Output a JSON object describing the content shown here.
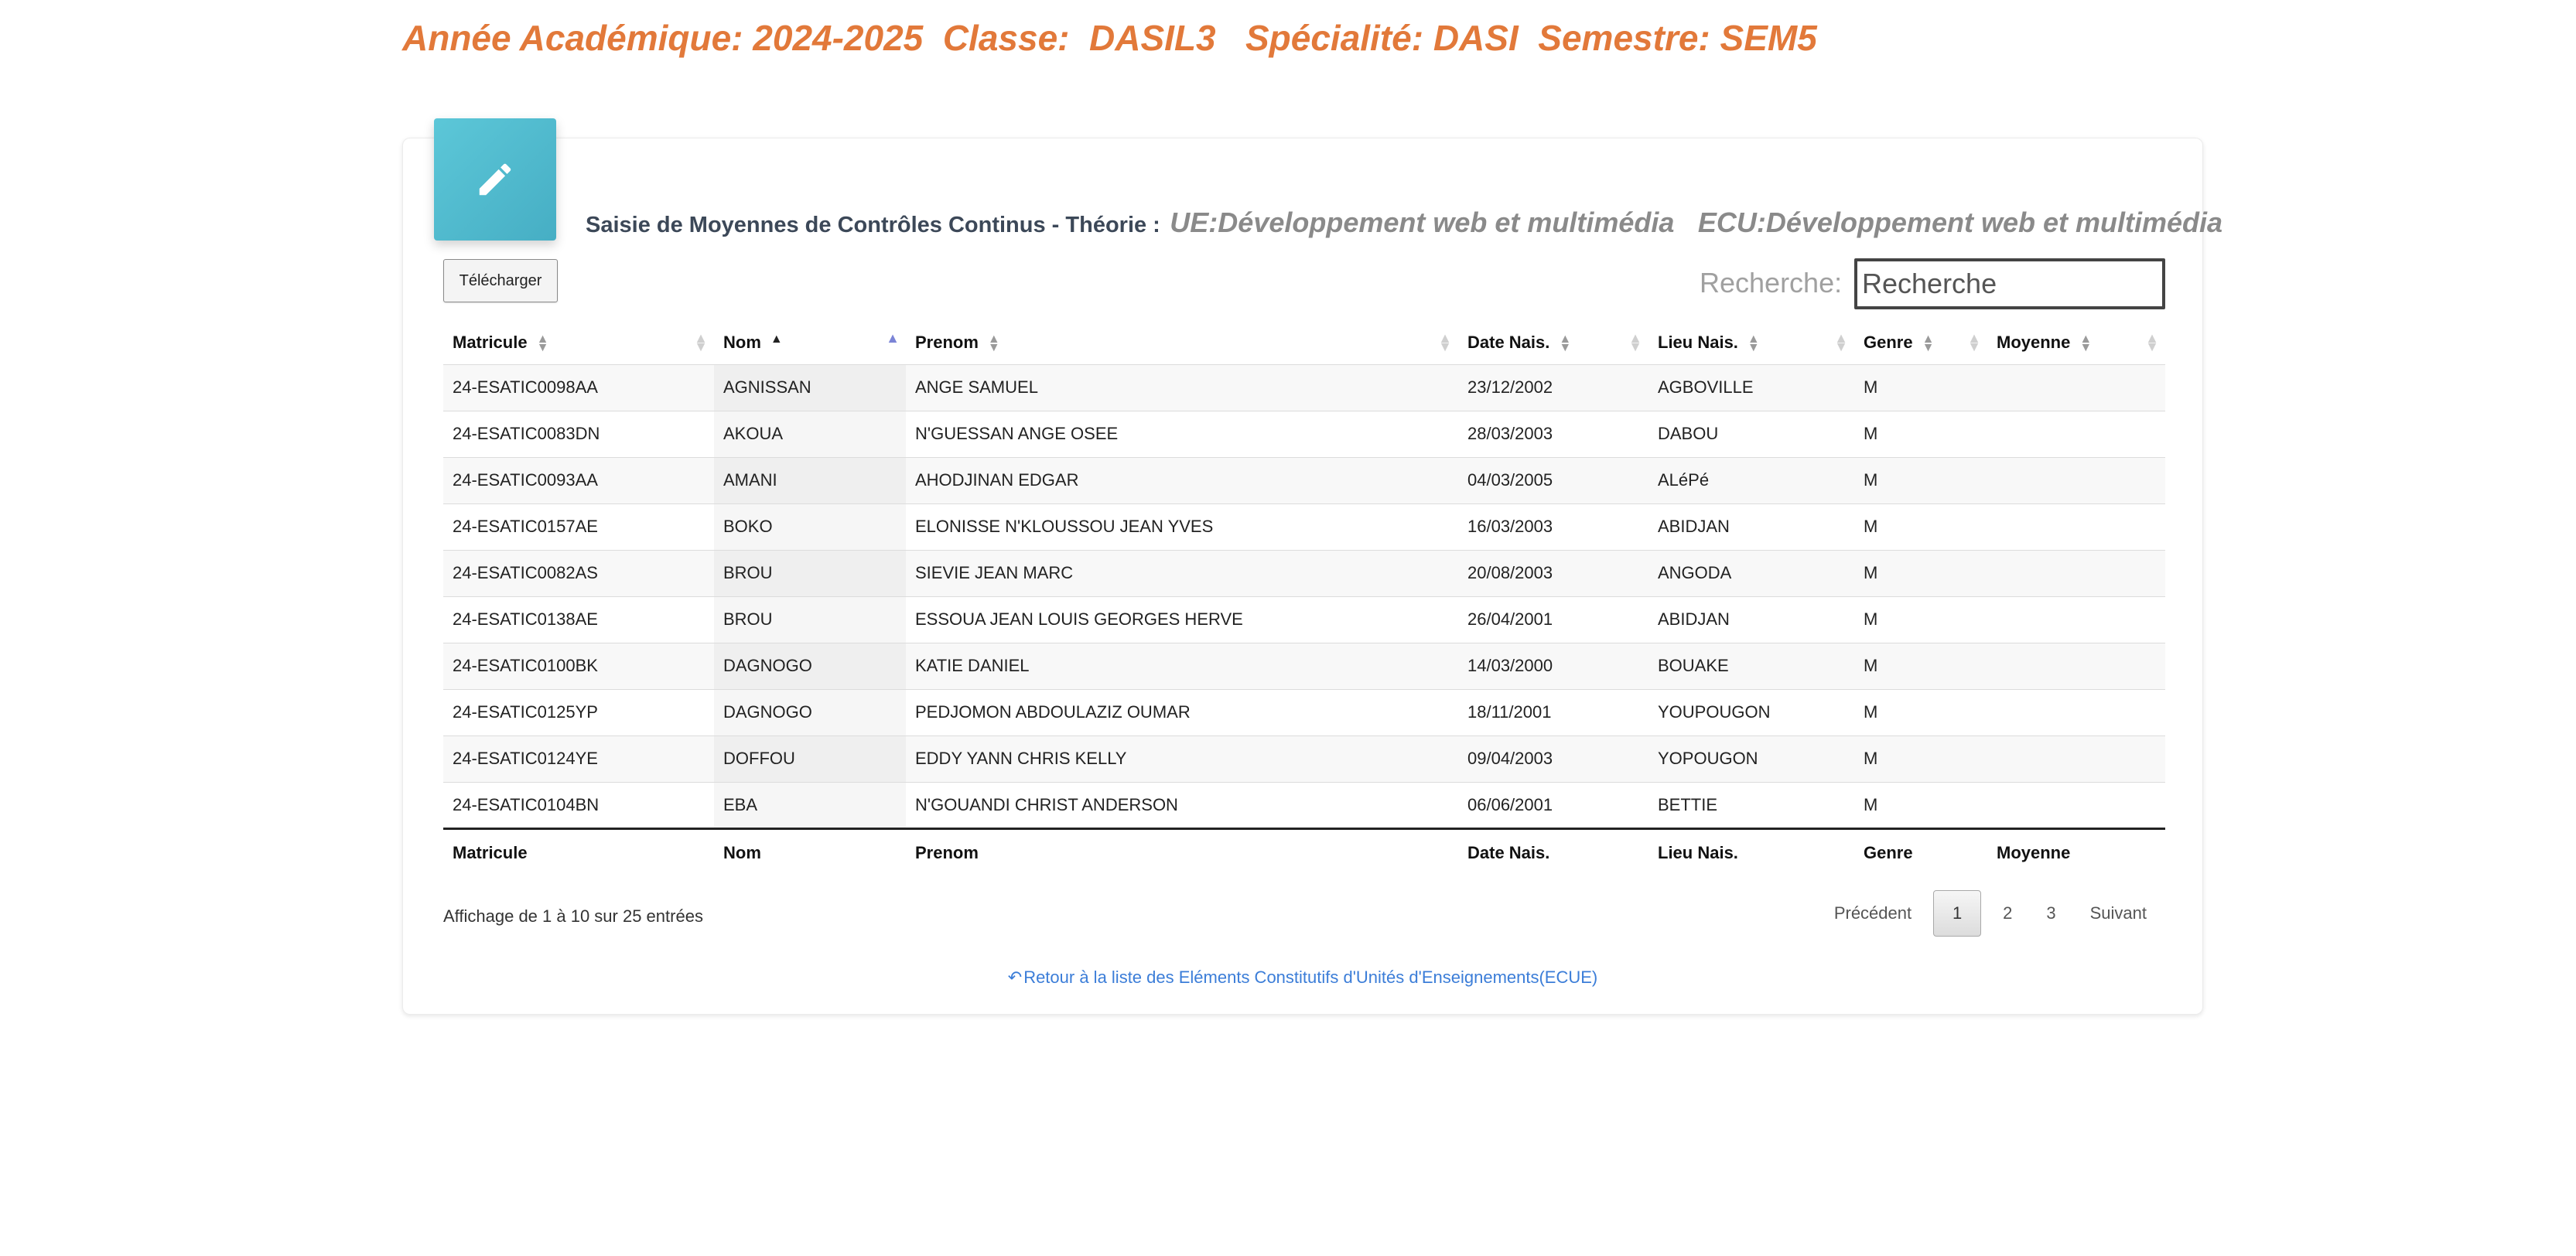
{
  "header": {
    "text": "Année Académique: 2024-2025  Classe:  DASIL3   Spécialité: DASI  Semestre: SEM5"
  },
  "card": {
    "title": "Saisie de Moyennes de Contrôles Continus - Théorie :",
    "ue": "UE:Développement web et multimédia",
    "ecu": "ECU:Développement web et multimédia",
    "icon": "pencil-icon",
    "accent_color": "#52bdd0"
  },
  "toolbar": {
    "download_label": "Télécharger",
    "search_label": "Recherche:",
    "search_placeholder": "Recherche",
    "search_value": ""
  },
  "table": {
    "columns": [
      "Matricule",
      "Nom",
      "Prenom",
      "Date Nais.",
      "Lieu Nais.",
      "Genre",
      "Moyenne"
    ],
    "sorted_column": "Nom",
    "sort_direction": "asc",
    "rows": [
      [
        "24-ESATIC0098AA",
        "AGNISSAN",
        "ANGE SAMUEL",
        "23/12/2002",
        "AGBOVILLE",
        "M",
        ""
      ],
      [
        "24-ESATIC0083DN",
        "AKOUA",
        "N'GUESSAN ANGE OSEE",
        "28/03/2003",
        "DABOU",
        "M",
        ""
      ],
      [
        "24-ESATIC0093AA",
        "AMANI",
        "AHODJINAN EDGAR",
        "04/03/2005",
        "ALéPé",
        "M",
        ""
      ],
      [
        "24-ESATIC0157AE",
        "BOKO",
        "ELONISSE N'KLOUSSOU JEAN YVES",
        "16/03/2003",
        "ABIDJAN",
        "M",
        ""
      ],
      [
        "24-ESATIC0082AS",
        "BROU",
        "SIEVIE JEAN MARC",
        "20/08/2003",
        "ANGODA",
        "M",
        ""
      ],
      [
        "24-ESATIC0138AE",
        "BROU",
        "ESSOUA JEAN LOUIS GEORGES HERVE",
        "26/04/2001",
        "ABIDJAN",
        "M",
        ""
      ],
      [
        "24-ESATIC0100BK",
        "DAGNOGO",
        "KATIE DANIEL",
        "14/03/2000",
        "BOUAKE",
        "M",
        ""
      ],
      [
        "24-ESATIC0125YP",
        "DAGNOGO",
        "PEDJOMON ABDOULAZIZ OUMAR",
        "18/11/2001",
        "YOUPOUGON",
        "M",
        ""
      ],
      [
        "24-ESATIC0124YE",
        "DOFFOU",
        "EDDY YANN CHRIS KELLY",
        "09/04/2003",
        "YOPOUGON",
        "M",
        ""
      ],
      [
        "24-ESATIC0104BN",
        "EBA",
        "N'GOUANDI CHRIST ANDERSON",
        "06/06/2001",
        "BETTIE",
        "M",
        ""
      ]
    ]
  },
  "footer": {
    "info": "Affichage de 1 à 10 sur 25 entrées",
    "prev_label": "Précédent",
    "pages": [
      "1",
      "2",
      "3"
    ],
    "current_page": "1",
    "next_label": "Suivant",
    "back_link": "Retour à la liste des Eléments Constitutifs d'Unités d'Enseignements(ECUE)",
    "back_icon": "reply-icon"
  },
  "colors": {
    "header_orange": "#e2793a",
    "link_blue": "#3b7dd8"
  }
}
